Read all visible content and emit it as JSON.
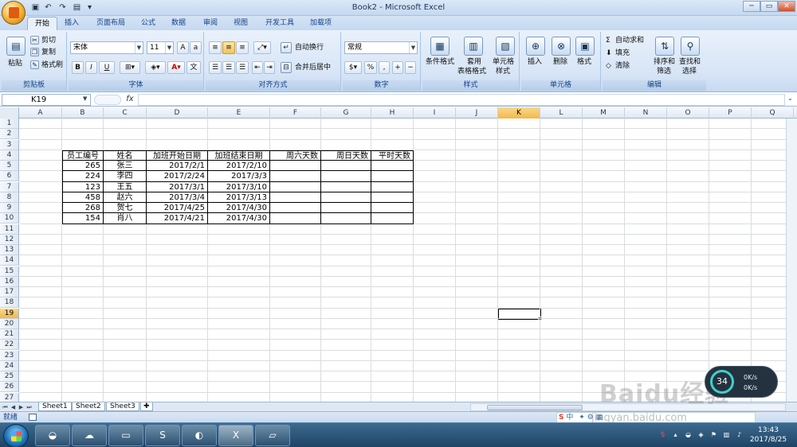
{
  "window": {
    "title": "Book2 - Microsoft Excel"
  },
  "quick_access": {
    "save_icon": "save-icon",
    "undo_icon": "undo-icon",
    "redo_icon": "redo-icon"
  },
  "window_controls": {
    "minimize": "─",
    "restore": "▭",
    "close": "✕"
  },
  "tabs": [
    "开始",
    "插入",
    "页面布局",
    "公式",
    "数据",
    "审阅",
    "视图",
    "开发工具",
    "加载项"
  ],
  "active_tab": "开始",
  "ribbon": {
    "clipboard": {
      "label": "剪贴板",
      "paste": "粘贴",
      "cut": "剪切",
      "copy": "复制",
      "format_painter": "格式刷"
    },
    "font": {
      "label": "字体",
      "font_name": "宋体",
      "font_size": "11",
      "bold": "B",
      "italic": "I",
      "underline": "U"
    },
    "alignment": {
      "label": "对齐方式",
      "wrap_text": "自动换行",
      "merge_center": "合并后居中"
    },
    "number": {
      "label": "数字",
      "format": "常规",
      "percent": "%"
    },
    "styles": {
      "label": "样式",
      "conditional": "条件格式",
      "table_format_l1": "套用",
      "table_format_l2": "表格格式",
      "cell_styles_l1": "单元格",
      "cell_styles_l2": "样式"
    },
    "cells": {
      "label": "单元格",
      "insert": "插入",
      "delete": "删除",
      "format": "格式"
    },
    "editing": {
      "label": "编辑",
      "autosum": "自动求和",
      "fill": "填充",
      "clear": "清除",
      "sort_l1": "排序和",
      "sort_l2": "筛选",
      "find_l1": "查找和",
      "find_l2": "选择"
    }
  },
  "formula_bar": {
    "name_box": "K19",
    "fx": "fx",
    "value": ""
  },
  "sheet": {
    "columns": [
      "A",
      "B",
      "C",
      "D",
      "E",
      "F",
      "G",
      "H",
      "I",
      "J",
      "K",
      "L",
      "M",
      "N",
      "O",
      "P",
      "Q"
    ],
    "rows": [
      "1",
      "2",
      "3",
      "4",
      "5",
      "6",
      "7",
      "8",
      "9",
      "10",
      "11",
      "12",
      "13",
      "14",
      "15",
      "16",
      "17",
      "18",
      "19",
      "20",
      "21",
      "22",
      "23",
      "24",
      "25",
      "26",
      "27"
    ],
    "selected_cell": "K19",
    "table": {
      "headers": [
        "员工编号",
        "姓名",
        "加班开始日期",
        "加班结束日期",
        "周六天数",
        "周日天数",
        "平时天数"
      ],
      "rows": [
        [
          "265",
          "张三",
          "2017/2/1",
          "2017/2/10",
          "",
          "",
          ""
        ],
        [
          "224",
          "李四",
          "2017/2/24",
          "2017/3/3",
          "",
          "",
          ""
        ],
        [
          "123",
          "王五",
          "2017/3/1",
          "2017/3/10",
          "",
          "",
          ""
        ],
        [
          "458",
          "赵六",
          "2017/3/4",
          "2017/3/13",
          "",
          "",
          ""
        ],
        [
          "268",
          "贺七",
          "2017/4/25",
          "2017/4/30",
          "",
          "",
          ""
        ],
        [
          "154",
          "肖八",
          "2017/4/21",
          "2017/4/30",
          "",
          "",
          ""
        ]
      ]
    }
  },
  "sheet_tabs": [
    "Sheet1",
    "Sheet2",
    "Sheet3"
  ],
  "status": {
    "text": "就绪"
  },
  "taskbar": {
    "time": "13:43",
    "date": "2017/8/25"
  },
  "speed_widget": {
    "percent": "34",
    "up": "0K/s",
    "down": "0K/s"
  },
  "ime": {
    "label": "中"
  },
  "watermark": {
    "text": "Baidu经验",
    "url": "jingyan.baidu.com"
  },
  "colors": {
    "ribbon": "#d7e5f6",
    "selected_header": "#f3b74a",
    "taskbar": "#2a5478"
  }
}
